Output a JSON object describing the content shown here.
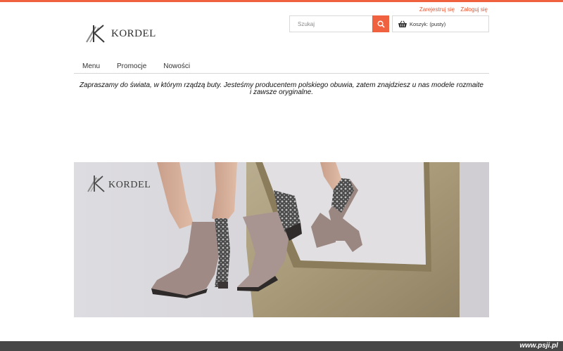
{
  "header": {
    "auth": {
      "register_label": "Zarejestruj się",
      "login_label": "Zaloguj się"
    },
    "logo_text": "KORDEL",
    "search": {
      "placeholder": "Szukaj"
    },
    "cart": {
      "label": "Koszyk: (pusty)"
    }
  },
  "nav": {
    "items": [
      {
        "label": "Menu"
      },
      {
        "label": "Promocje"
      },
      {
        "label": "Nowości"
      }
    ]
  },
  "intro_text": "Zapraszamy do świata, w którym rządzą buty. Jesteśmy producentem polskiego obuwia, zatem znajdziesz u nas modele rozmaite  i zawsze oryginalne.",
  "banner": {
    "logo_text": "KORDEL"
  },
  "footer": {
    "watermark": "www.psji.pl"
  },
  "colors": {
    "accent": "#f0623f",
    "bottom_bar": "#474747"
  },
  "icons": {
    "search": "search-icon",
    "cart": "basket-icon"
  }
}
